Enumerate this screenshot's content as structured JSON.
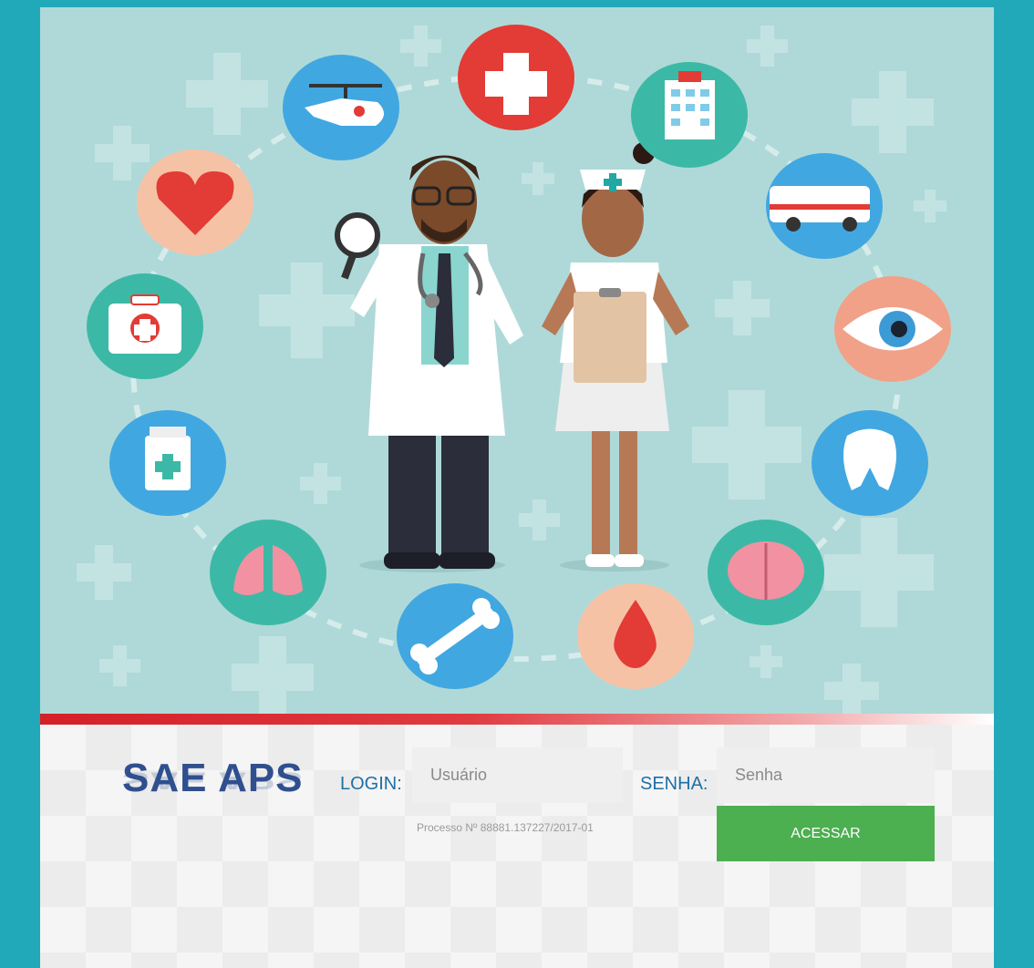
{
  "brand": {
    "logo_text": "SAE APS"
  },
  "form": {
    "login_label": "LOGIN:",
    "login_placeholder": "Usuário",
    "password_label": "SENHA:",
    "password_placeholder": "Senha",
    "submit_label": "ACESSAR",
    "process_text": "Processo Nº 88881.137227/2017-01"
  },
  "colors": {
    "outer_background": "#22a9b9",
    "hero_background": "#afd9d8",
    "accent_red": "#d42027",
    "submit_green": "#4caf50",
    "label_blue": "#1f6fa7",
    "logo_blue": "#2f4f8f"
  },
  "illustration": {
    "figures": [
      "doctor",
      "nurse"
    ],
    "icons": [
      "first-aid-cross-icon",
      "hospital-icon",
      "ambulance-icon",
      "eye-icon",
      "tooth-icon",
      "brain-icon",
      "blood-drop-icon",
      "bone-icon",
      "lungs-icon",
      "medicine-bottle-icon",
      "first-aid-kit-icon",
      "heart-icon",
      "helicopter-icon"
    ]
  }
}
